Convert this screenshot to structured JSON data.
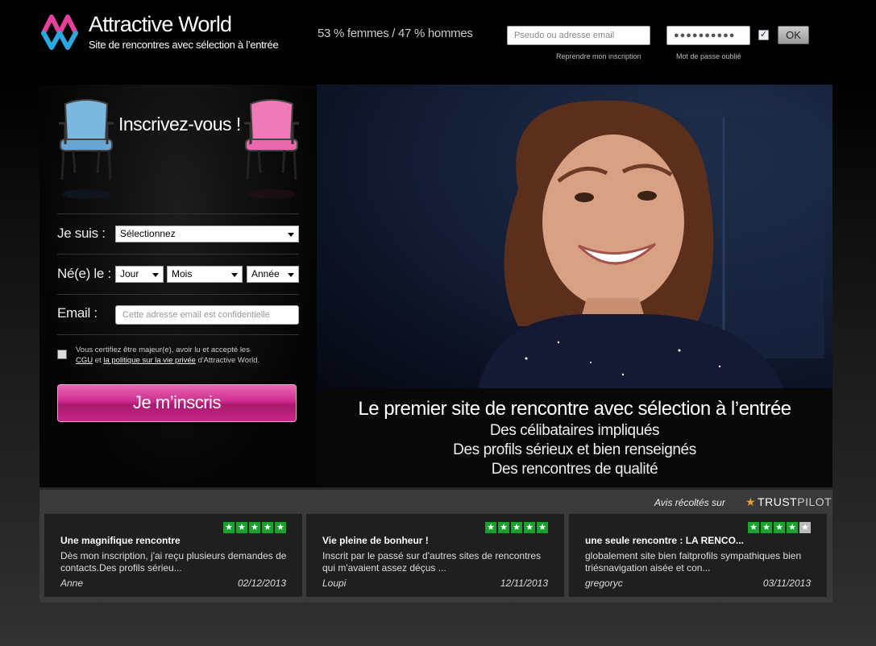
{
  "header": {
    "logo_title": "Attractive World",
    "logo_subtitle": "Site de rencontres avec sélection à l’entrée",
    "ratio": "53 % femmes / 47 % hommes",
    "login_placeholder": "Pseudo ou adresse email",
    "password_mask": "●●●●●●●●●●",
    "remember_check": "✓",
    "ok_label": "OK",
    "resume_link": "Reprendre mon inscription",
    "forgot_link": "Mot de passe oublié"
  },
  "signup": {
    "title": "Inscrivez-vous !",
    "gender_label": "Je suis :",
    "gender_value": "Sélectionnez",
    "birth_label": "Né(e) le :",
    "day_value": "Jour",
    "month_value": "Mois",
    "year_value": "Année",
    "email_label": "Email :",
    "email_placeholder": "Cette adresse email est confidentielle",
    "terms_pre": "Vous certifiez être majeur(e), avoir lu et accepté les",
    "terms_cgu": "CGU",
    "terms_and": "et",
    "terms_privacy": "la politique sur la vie privée",
    "terms_post": "d'Attractive World.",
    "submit_label": "Je m’inscris"
  },
  "hero": {
    "line1": "Le premier site de rencontre avec sélection à l’entrée",
    "line2": "Des célibataires impliqués",
    "line3": "Des profils sérieux et bien renseignés",
    "line4": "Des rencontres de qualité"
  },
  "reviews": {
    "collected_label": "Avis récoltés sur",
    "trustpilot_bold": "TRUST",
    "trustpilot_thin": "PILOT",
    "items": [
      {
        "title": "Une magnifique rencontre",
        "text": "Dès mon inscription, j'ai reçu plusieurs demandes de contacts.Des profils sérieu...",
        "author": "Anne",
        "date": "02/12/2013",
        "rating": 5
      },
      {
        "title": "Vie pleine de bonheur !",
        "text": "Inscrit par le passé sur d'autres sites de rencontres qui m'avaient assez déçus ...",
        "author": "Loupi",
        "date": "12/11/2013",
        "rating": 5
      },
      {
        "title": "une seule rencontre : LA RENCO...",
        "text": "globalement site bien faitprofils sympathiques bien triésnavigation aisée et con...",
        "author": "gregoryc",
        "date": "03/11/2013",
        "rating": 4
      }
    ]
  },
  "colors": {
    "accent_pink": "#cf2b8d",
    "logo_blue": "#2aa8e0",
    "trustpilot_green": "#1aa22e"
  }
}
